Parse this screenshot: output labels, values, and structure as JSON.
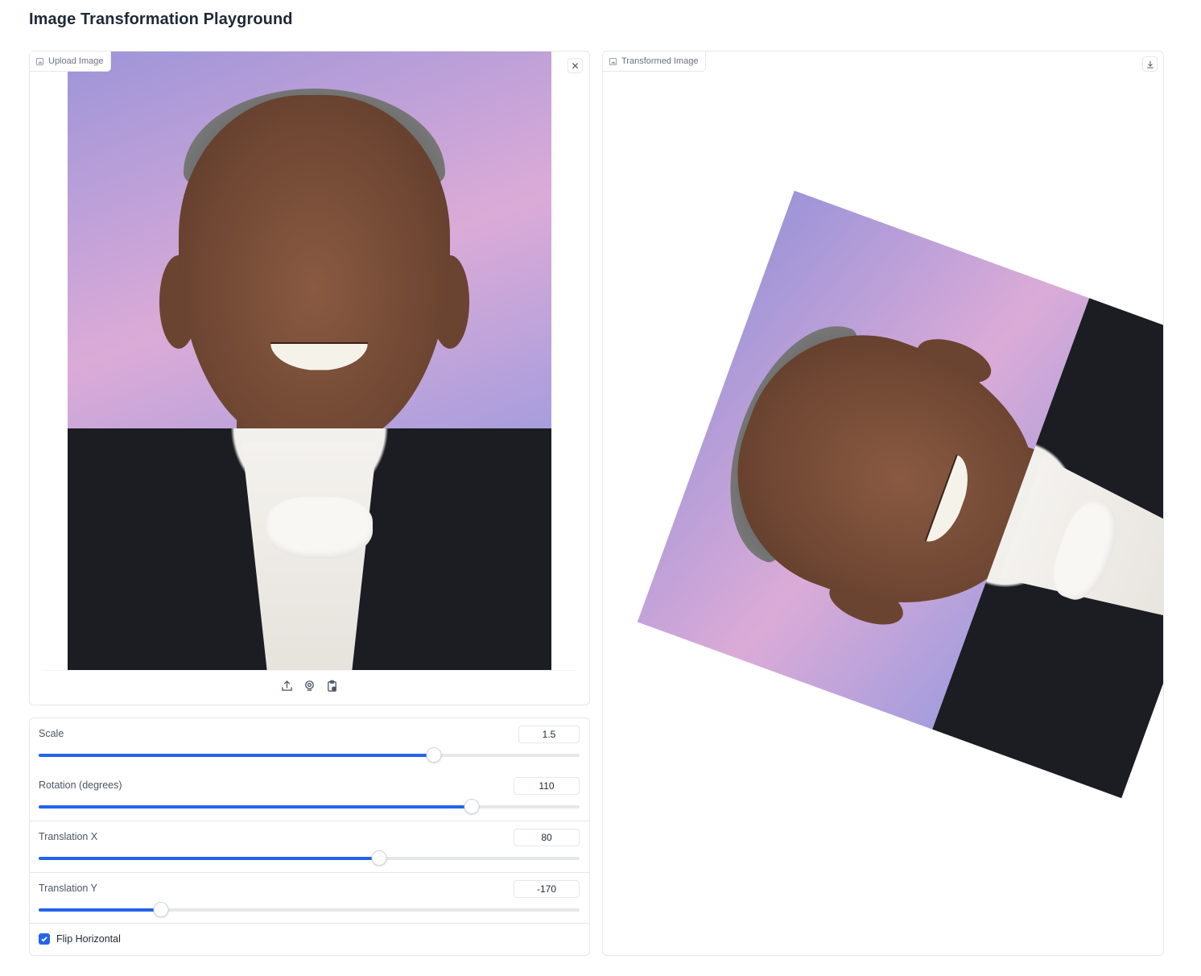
{
  "app": {
    "title": "Image Transformation Playground"
  },
  "input_panel": {
    "label": "Upload Image",
    "icon": "image-icon",
    "clear_icon": "close-icon",
    "tools": [
      "upload-icon",
      "webcam-icon",
      "clipboard-icon"
    ]
  },
  "output_panel": {
    "label": "Transformed Image",
    "icon": "image-icon",
    "download_icon": "download-icon"
  },
  "controls": {
    "scale": {
      "label": "Scale",
      "value": "1.5",
      "fraction": 0.73
    },
    "rotation": {
      "label": "Rotation (degrees)",
      "value": "110",
      "fraction": 0.8
    },
    "translation_x": {
      "label": "Translation X",
      "value": "80",
      "fraction": 0.63
    },
    "translation_y": {
      "label": "Translation Y",
      "value": "-170",
      "fraction": 0.226
    },
    "flip_horizontal": {
      "label": "Flip Horizontal",
      "checked": true
    }
  },
  "colors": {
    "accent": "#2563eb",
    "border": "#e5e7eb",
    "text": "#1f2937"
  }
}
